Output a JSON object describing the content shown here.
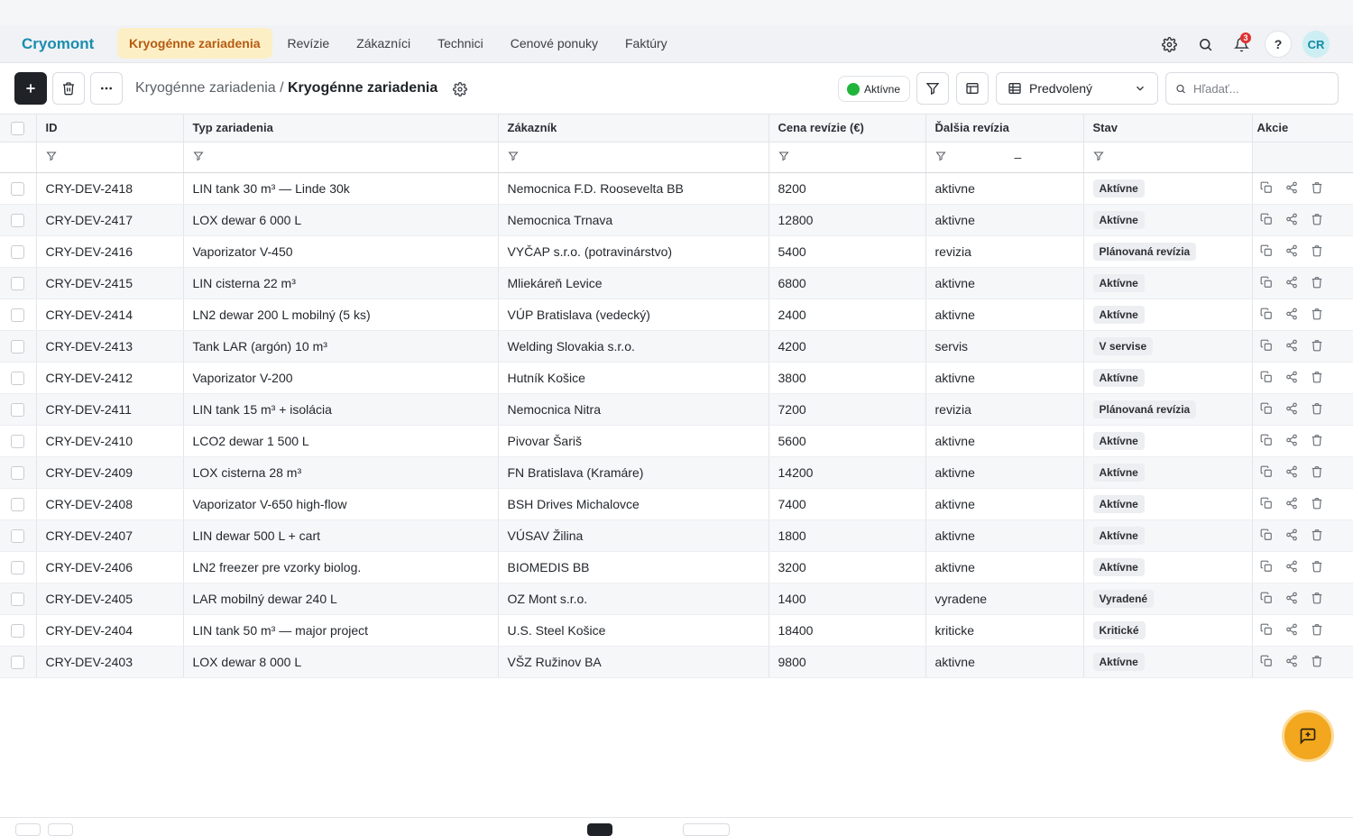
{
  "nav": {
    "brand": "Cryomont",
    "links": [
      {
        "label": "Kryogénne zariadenia",
        "active": true
      },
      {
        "label": "Revízie"
      },
      {
        "label": "Zákazníci"
      },
      {
        "label": "Technici"
      },
      {
        "label": "Cenové ponuky"
      },
      {
        "label": "Faktúry"
      }
    ],
    "notifications_count": "3",
    "help_label": "?",
    "avatar_initials": "CR"
  },
  "toolbar": {
    "breadcrumb_parent": "Kryogénne zariadenia / ",
    "breadcrumb_current": "Kryogénne zariadenia",
    "status_filter": "Aktívne",
    "view_label": "Predvolený",
    "search_placeholder": "Hľadať..."
  },
  "table": {
    "columns": [
      "ID",
      "Typ zariadenia",
      "Zákazník",
      "Cena revízie (€)",
      "Ďalšia revízia",
      "Stav",
      "Akcie"
    ],
    "date_filter_dash": "–",
    "rows": [
      {
        "id": "CRY-DEV-2418",
        "type": "LIN tank 30 m³ — Linde 30k",
        "customer": "Nemocnica F.D. Roosevelta BB",
        "price": "8200",
        "next": "aktivne",
        "status": "Aktívne"
      },
      {
        "id": "CRY-DEV-2417",
        "type": "LOX dewar 6 000 L",
        "customer": "Nemocnica Trnava",
        "price": "12800",
        "next": "aktivne",
        "status": "Aktívne"
      },
      {
        "id": "CRY-DEV-2416",
        "type": "Vaporizator V-450",
        "customer": "VYČAP s.r.o. (potravinárstvo)",
        "price": "5400",
        "next": "revizia",
        "status": "Plánovaná revízia"
      },
      {
        "id": "CRY-DEV-2415",
        "type": "LIN cisterna 22 m³",
        "customer": "Mliekáreň Levice",
        "price": "6800",
        "next": "aktivne",
        "status": "Aktívne"
      },
      {
        "id": "CRY-DEV-2414",
        "type": "LN2 dewar 200 L mobilný (5 ks)",
        "customer": "VÚP Bratislava (vedecký)",
        "price": "2400",
        "next": "aktivne",
        "status": "Aktívne"
      },
      {
        "id": "CRY-DEV-2413",
        "type": "Tank LAR (argón) 10 m³",
        "customer": "Welding Slovakia s.r.o.",
        "price": "4200",
        "next": "servis",
        "status": "V servise"
      },
      {
        "id": "CRY-DEV-2412",
        "type": "Vaporizator V-200",
        "customer": "Hutník Košice",
        "price": "3800",
        "next": "aktivne",
        "status": "Aktívne"
      },
      {
        "id": "CRY-DEV-2411",
        "type": "LIN tank 15 m³ + isolácia",
        "customer": "Nemocnica Nitra",
        "price": "7200",
        "next": "revizia",
        "status": "Plánovaná revízia"
      },
      {
        "id": "CRY-DEV-2410",
        "type": "LCO2 dewar 1 500 L",
        "customer": "Pivovar Šariš",
        "price": "5600",
        "next": "aktivne",
        "status": "Aktívne"
      },
      {
        "id": "CRY-DEV-2409",
        "type": "LOX cisterna 28 m³",
        "customer": "FN Bratislava (Kramáre)",
        "price": "14200",
        "next": "aktivne",
        "status": "Aktívne"
      },
      {
        "id": "CRY-DEV-2408",
        "type": "Vaporizator V-650 high-flow",
        "customer": "BSH Drives Michalovce",
        "price": "7400",
        "next": "aktivne",
        "status": "Aktívne"
      },
      {
        "id": "CRY-DEV-2407",
        "type": "LIN dewar 500 L + cart",
        "customer": "VÚSAV Žilina",
        "price": "1800",
        "next": "aktivne",
        "status": "Aktívne"
      },
      {
        "id": "CRY-DEV-2406",
        "type": "LN2 freezer pre vzorky biolog.",
        "customer": "BIOMEDIS BB",
        "price": "3200",
        "next": "aktivne",
        "status": "Aktívne"
      },
      {
        "id": "CRY-DEV-2405",
        "type": "LAR mobilný dewar 240 L",
        "customer": "OZ Mont s.r.o.",
        "price": "1400",
        "next": "vyradene",
        "status": "Vyradené"
      },
      {
        "id": "CRY-DEV-2404",
        "type": "LIN tank 50 m³ — major project",
        "customer": "U.S. Steel Košice",
        "price": "18400",
        "next": "kriticke",
        "status": "Kritické"
      },
      {
        "id": "CRY-DEV-2403",
        "type": "LOX dewar 8 000 L",
        "customer": "VŠZ Ružinov BA",
        "price": "9800",
        "next": "aktivne",
        "status": "Aktívne"
      }
    ]
  },
  "icons": {
    "settings": "gear-icon",
    "search": "search-icon",
    "notifications": "bell-icon",
    "filter": "filter-icon",
    "copy": "copy-icon",
    "share": "share-icon",
    "delete": "trash-icon",
    "feedback": "feedback-icon"
  },
  "colors": {
    "brand": "#1a8db0",
    "active_nav_bg": "#fdefc5",
    "active_nav_text": "#b65b12",
    "status_dot": "#1fb53a",
    "fab": "#f2a71f",
    "badge": "#e03131"
  }
}
